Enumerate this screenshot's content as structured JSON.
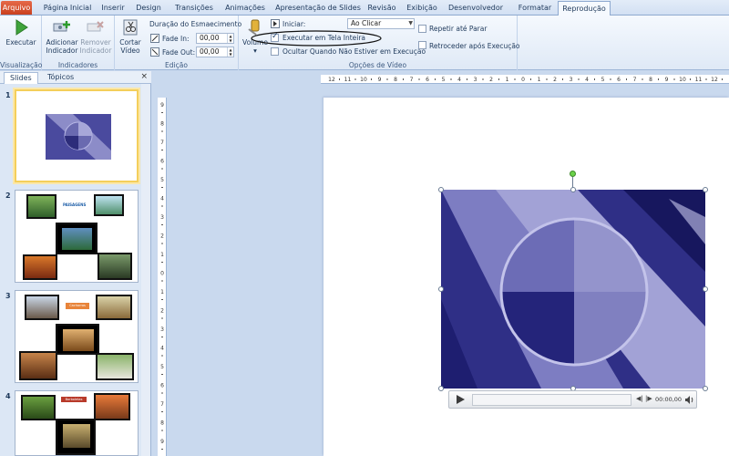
{
  "tabs": [
    "Arquivo",
    "Página Inicial",
    "Inserir",
    "Design",
    "Transições",
    "Animações",
    "Apresentação de Slides",
    "Revisão",
    "Exibição",
    "Desenvolvedor",
    "Formatar",
    "Reprodução"
  ],
  "ribbon": {
    "visualizacao": {
      "play_label": "Executar",
      "group_label": "Visualização"
    },
    "indicadores": {
      "add_label_1": "Adicionar",
      "add_label_2": "Indicador",
      "remove_label_1": "Remover",
      "remove_label_2": "Indicador",
      "group_label": "Indicadores"
    },
    "edicao": {
      "trim_label_1": "Cortar",
      "trim_label_2": "Vídeo",
      "fade_title": "Duração do Esmaecimento",
      "fade_in_label": "Fade In:",
      "fade_in_value": "00,00",
      "fade_out_label": "Fade Out:",
      "fade_out_value": "00,00",
      "group_label": "Edição"
    },
    "opcoes": {
      "volume_label": "Volume",
      "iniciar_label": "Iniciar:",
      "iniciar_value": "Ao Clicar",
      "fullscreen_label": "Executar em Tela Inteira",
      "hide_label": "Ocultar Quando Não Estiver em Execução",
      "loop_label": "Repetir até Parar",
      "rewind_label": "Retroceder após Execução",
      "group_label": "Opções de Vídeo"
    }
  },
  "pane": {
    "tab_slides": "Slides",
    "tab_topicos": "Tópicos",
    "close": "×"
  },
  "slides": [
    {
      "number": "1"
    },
    {
      "number": "2",
      "caption": "PAISAGENS"
    },
    {
      "number": "3",
      "caption": "Cachorros"
    },
    {
      "number": "4",
      "caption": "Borboletas"
    }
  ],
  "ruler": {
    "h_ticks": [
      "12",
      "11",
      "10",
      "9",
      "8",
      "7",
      "6",
      "5",
      "4",
      "3",
      "2",
      "1",
      "0",
      "1",
      "2",
      "3",
      "4",
      "5",
      "6",
      "7",
      "8",
      "9",
      "10",
      "11",
      "12"
    ],
    "v_ticks": [
      "9",
      "8",
      "7",
      "6",
      "5",
      "4",
      "3",
      "2",
      "1",
      "0",
      "1",
      "2",
      "3",
      "4",
      "5",
      "6",
      "7",
      "8",
      "9"
    ]
  },
  "player": {
    "time": "00:00,00"
  },
  "colors": {
    "accent": "#c9401e",
    "ribbon_bg": "#dfe9f6",
    "video_blue": "#3d3d8f"
  }
}
